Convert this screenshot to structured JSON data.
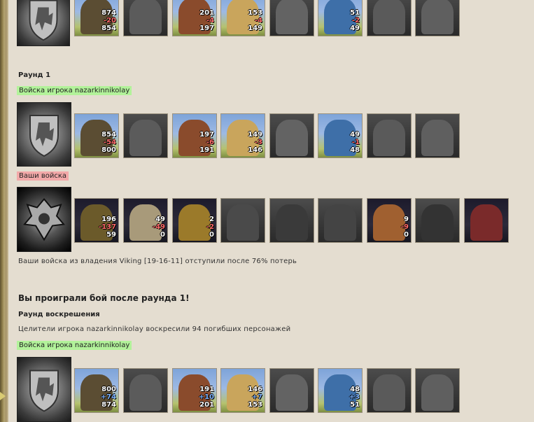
{
  "army0": {
    "units": [
      {
        "n1": "874",
        "n2": "-20",
        "n3": "854"
      },
      {
        "n1": "",
        "n2": "",
        "n3": ""
      },
      {
        "n1": "201",
        "n2": "-4",
        "n3": "197"
      },
      {
        "n1": "153",
        "n2": "-4",
        "n3": "149"
      },
      {
        "n1": "",
        "n2": "",
        "n3": ""
      },
      {
        "n1": "51",
        "n2": "-2",
        "n3": "49"
      },
      {
        "n1": "",
        "n2": "",
        "n3": ""
      },
      {
        "n1": "",
        "n2": "",
        "n3": ""
      }
    ]
  },
  "round1": {
    "title": "Раунд 1",
    "player_label": "Войска игрока nazarkinnikolay",
    "player_units": [
      {
        "n1": "854",
        "n2": "-54",
        "n3": "800"
      },
      {
        "n1": "",
        "n2": "",
        "n3": ""
      },
      {
        "n1": "197",
        "n2": "-6",
        "n3": "191"
      },
      {
        "n1": "149",
        "n2": "-3",
        "n3": "146"
      },
      {
        "n1": "",
        "n2": "",
        "n3": ""
      },
      {
        "n1": "49",
        "n2": "-1",
        "n3": "48"
      },
      {
        "n1": "",
        "n2": "",
        "n3": ""
      },
      {
        "n1": "",
        "n2": "",
        "n3": ""
      }
    ],
    "enemy_label": "Ваши войска",
    "enemy_units": [
      {
        "n1": "196",
        "n2": "-137",
        "n3": "59"
      },
      {
        "n1": "49",
        "n2": "-49",
        "n3": "0"
      },
      {
        "n1": "2",
        "n2": "-2",
        "n3": "0"
      },
      {
        "n1": "",
        "n2": "",
        "n3": ""
      },
      {
        "n1": "",
        "n2": "",
        "n3": ""
      },
      {
        "n1": "",
        "n2": "",
        "n3": ""
      },
      {
        "n1": "9",
        "n2": "-9",
        "n3": "0"
      },
      {
        "n1": "",
        "n2": "",
        "n3": ""
      },
      {
        "n1": "",
        "n2": "",
        "n3": ""
      }
    ],
    "retreat_text": "Ваши войска из владения Viking [19-16-11] отступили после 76% потерь"
  },
  "result": "Вы проиграли бой после раунда 1!",
  "resurrection": {
    "title": "Раунд воскрешения",
    "text": "Целители игрока nazarkinnikolay воскресили 94 погибших персонажей",
    "player_label": "Войска игрока nazarkinnikolay",
    "units": [
      {
        "n1": "800",
        "n2": "+74",
        "n3": "874"
      },
      {
        "n1": "",
        "n2": "",
        "n3": ""
      },
      {
        "n1": "191",
        "n2": "+10",
        "n3": "201"
      },
      {
        "n1": "146",
        "n2": "+7",
        "n3": "153"
      },
      {
        "n1": "",
        "n2": "",
        "n3": ""
      },
      {
        "n1": "48",
        "n2": "+3",
        "n3": "51"
      },
      {
        "n1": "",
        "n2": "",
        "n3": ""
      },
      {
        "n1": "",
        "n2": "",
        "n3": ""
      }
    ]
  }
}
